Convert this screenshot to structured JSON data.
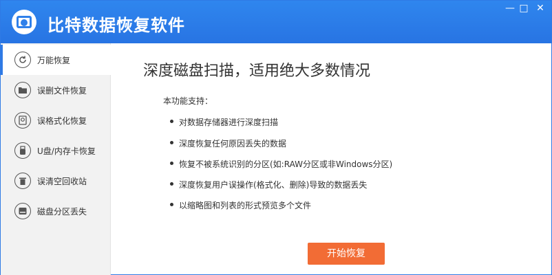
{
  "app": {
    "title": "比特数据恢复软件"
  },
  "window_controls": {
    "minimize": "—",
    "maximize": "□",
    "close": "✕"
  },
  "sidebar": {
    "items": [
      {
        "label": "万能恢复",
        "icon": "refresh-icon",
        "active": true
      },
      {
        "label": "误删文件恢复",
        "icon": "folder-icon",
        "active": false
      },
      {
        "label": "误格式化恢复",
        "icon": "disk-format-icon",
        "active": false
      },
      {
        "label": "U盘/内存卡恢复",
        "icon": "usb-icon",
        "active": false
      },
      {
        "label": "误清空回收站",
        "icon": "trash-icon",
        "active": false
      },
      {
        "label": "磁盘分区丢失",
        "icon": "partition-icon",
        "active": false
      }
    ]
  },
  "main": {
    "title": "深度磁盘扫描，适用绝大多数情况",
    "support_label": "本功能支持：",
    "features": [
      "对数据存储器进行深度扫描",
      "深度恢复任何原因丢失的数据",
      "恢复不被系统识别的分区(如:RAW分区或非Windows分区)",
      "深度恢复用户误操作(格式化、删除)导致的数据丢失",
      "以缩略图和列表的形式预览多个文件"
    ],
    "start_button": "开始恢复"
  },
  "colors": {
    "accent": "#2f7ae5",
    "button": "#f26c35"
  }
}
